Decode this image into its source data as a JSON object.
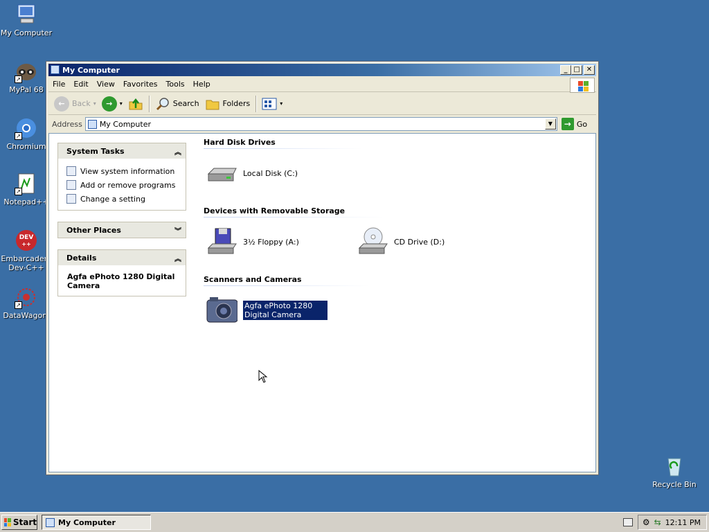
{
  "desktop": {
    "icons": [
      {
        "label": "My Computer",
        "icon": "my-computer-icon"
      },
      {
        "label": "MyPal 68",
        "icon": "mypal-icon"
      },
      {
        "label": "Chromium",
        "icon": "chromium-icon"
      },
      {
        "label": "Notepad++",
        "icon": "notepadpp-icon"
      },
      {
        "label": "Embarcadero Dev-C++",
        "icon": "devcpp-icon"
      },
      {
        "label": "DataWagon.",
        "icon": "datawagon-icon"
      },
      {
        "label": "Recycle Bin",
        "icon": "recycle-bin-icon"
      }
    ]
  },
  "window": {
    "title": "My Computer",
    "menu": [
      "File",
      "Edit",
      "View",
      "Favorites",
      "Tools",
      "Help"
    ],
    "toolbar": {
      "back": "Back",
      "search": "Search",
      "folders": "Folders"
    },
    "address": {
      "label": "Address",
      "value": "My Computer",
      "go": "Go"
    },
    "left_pane": {
      "system_tasks": {
        "title": "System Tasks",
        "items": [
          "View system information",
          "Add or remove programs",
          "Change a setting"
        ]
      },
      "other_places": {
        "title": "Other Places"
      },
      "details": {
        "title": "Details",
        "text": "Agfa ePhoto 1280 Digital Camera"
      }
    },
    "groups": {
      "hard_disks": {
        "title": "Hard Disk Drives",
        "items": [
          "Local Disk (C:)"
        ]
      },
      "removable": {
        "title": "Devices with Removable Storage",
        "items": [
          "3½ Floppy (A:)",
          "CD Drive (D:)"
        ]
      },
      "scanners": {
        "title": "Scanners and Cameras",
        "items": [
          "Agfa ePhoto 1280 Digital Camera"
        ]
      }
    }
  },
  "taskbar": {
    "start": "Start",
    "task": "My Computer",
    "clock": "12:11 PM"
  }
}
